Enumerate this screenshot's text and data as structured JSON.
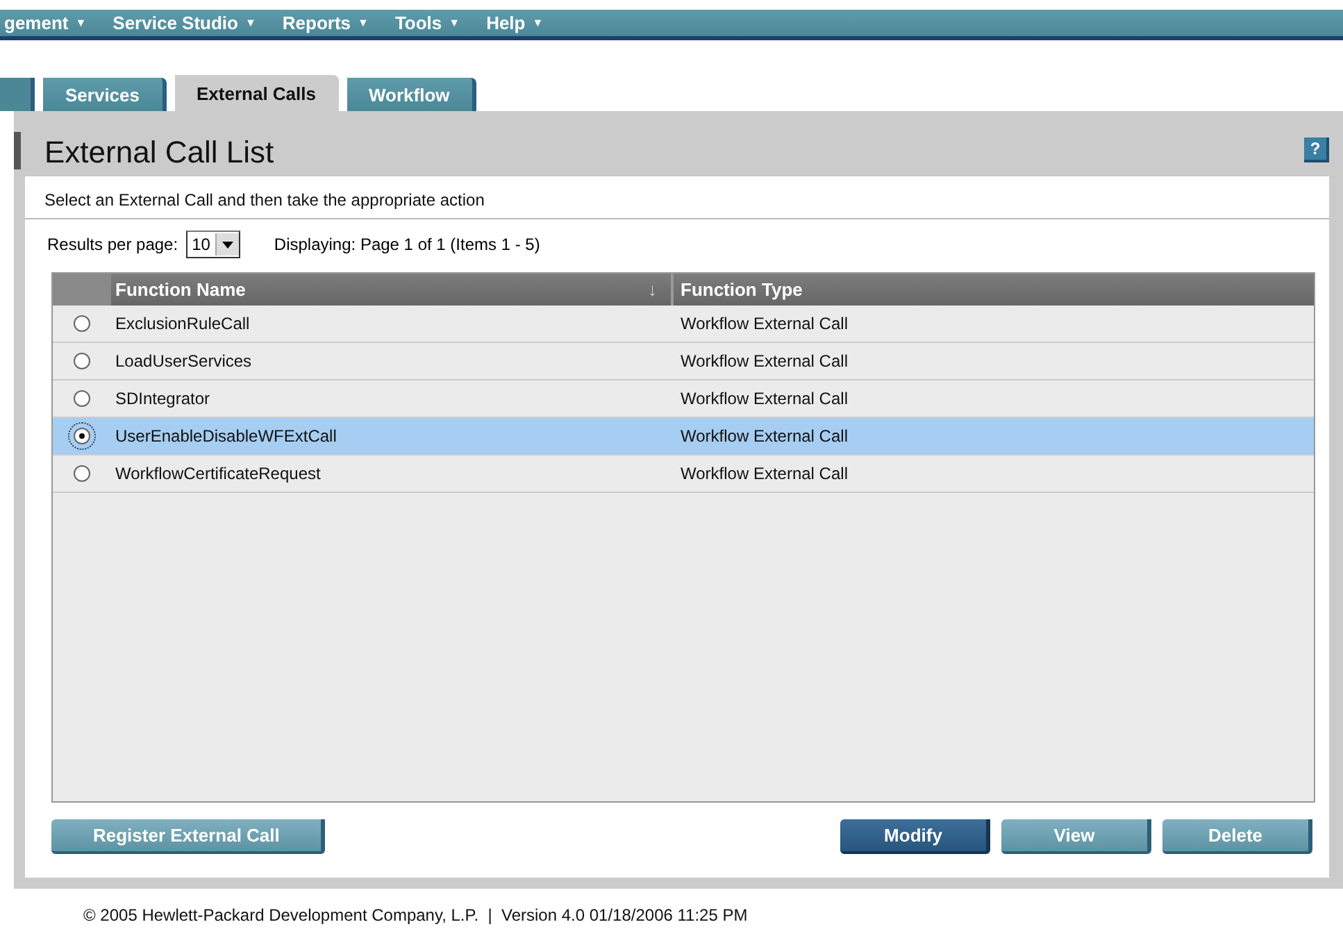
{
  "menu_bar": {
    "items": [
      {
        "label": "gement",
        "caret": "▼"
      },
      {
        "label": "Service Studio",
        "caret": "▼"
      },
      {
        "label": "Reports",
        "caret": "▼"
      },
      {
        "label": "Tools",
        "caret": "▼"
      },
      {
        "label": "Help",
        "caret": "▼"
      }
    ]
  },
  "tabs": [
    {
      "label": "Services",
      "selected": false
    },
    {
      "label": "External Calls",
      "selected": true
    },
    {
      "label": "Workflow",
      "selected": false
    }
  ],
  "panel": {
    "title": "External Call List",
    "help": "?",
    "instruction": "Select an External Call and then take the appropriate action",
    "results_per_page": {
      "label": "Results per page:",
      "value": "10"
    },
    "paging": "Displaying: Page 1 of 1 (Items 1 - 5)"
  },
  "table": {
    "columns": [
      {
        "label": "Function Name",
        "sort": "↓"
      },
      {
        "label": "Function Type"
      }
    ],
    "rows": [
      {
        "name": "ExclusionRuleCall",
        "type": "Workflow External Call",
        "selected": false
      },
      {
        "name": "LoadUserServices",
        "type": "Workflow External Call",
        "selected": false
      },
      {
        "name": "SDIntegrator",
        "type": "Workflow External Call",
        "selected": false
      },
      {
        "name": "UserEnableDisableWFExtCall",
        "type": "Workflow External Call",
        "selected": true
      },
      {
        "name": "WorkflowCertificateRequest",
        "type": "Workflow External Call",
        "selected": false
      }
    ]
  },
  "buttons": [
    {
      "label": "Register External Call",
      "kind": "left",
      "primary": false
    },
    {
      "label": "Modify",
      "kind": "right",
      "primary": true
    },
    {
      "label": "View",
      "kind": "right",
      "primary": false
    },
    {
      "label": "Delete",
      "kind": "right",
      "primary": false
    }
  ],
  "footer": "© 2005 Hewlett-Packard Development Company, L.P.  |  Version 4.0 01/18/2006 11:25 PM"
}
